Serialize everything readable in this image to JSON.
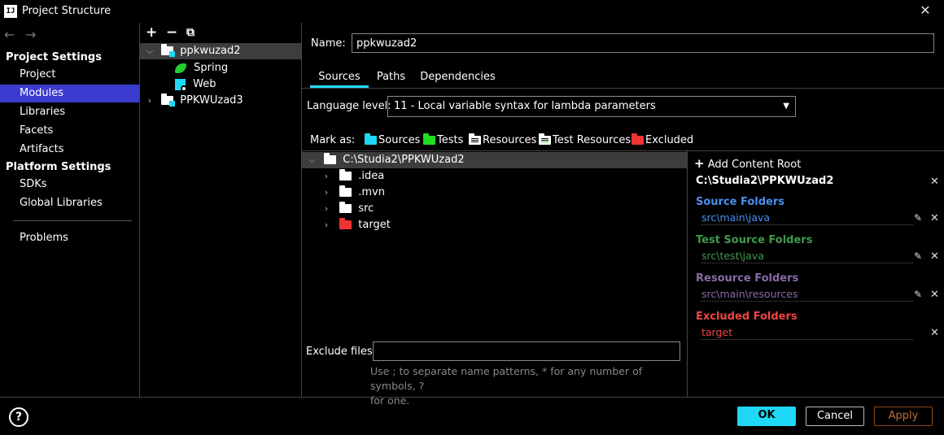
{
  "window": {
    "title": "Project Structure",
    "logo_text": "IJ",
    "close_glyph": "✕"
  },
  "nav": {
    "back_glyph": "←",
    "forward_glyph": "→",
    "project_settings_heading": "Project Settings",
    "project_items": [
      "Project",
      "Modules",
      "Libraries",
      "Facets",
      "Artifacts"
    ],
    "selected": "Modules",
    "platform_settings_heading": "Platform Settings",
    "platform_items": [
      "SDKs",
      "Global Libraries"
    ],
    "problems": "Problems"
  },
  "module_toolbar": {
    "add": "+",
    "remove": "−",
    "copy": "⧉"
  },
  "module_tree": {
    "module1": "ppkwuzad2",
    "facet_spring": "Spring",
    "facet_web": "Web",
    "module2": "PPKWUzad3"
  },
  "name_field": {
    "label": "Name:",
    "value": "ppkwuzad2"
  },
  "tabs": [
    "Sources",
    "Paths",
    "Dependencies"
  ],
  "selected_tab": "Sources",
  "language_level": {
    "label": "Language level:",
    "value": "11 - Local variable syntax for lambda parameters"
  },
  "mark_as": {
    "label": "Mark as:",
    "items": [
      {
        "label": "Sources",
        "color": "#1fd8f5"
      },
      {
        "label": "Tests",
        "color": "#22dd22"
      },
      {
        "label": "Resources",
        "color": "#ffffff"
      },
      {
        "label": "Test Resources",
        "color": "#ffffff"
      },
      {
        "label": "Excluded",
        "color": "#ee3333"
      }
    ]
  },
  "content_tree": {
    "root": "C:\\Studia2\\PPKWUzad2",
    "children": [
      {
        "name": ".idea",
        "color": "#ffffff"
      },
      {
        "name": ".mvn",
        "color": "#ffffff"
      },
      {
        "name": "src",
        "color": "#ffffff"
      },
      {
        "name": "target",
        "color": "#ee3333"
      }
    ]
  },
  "exclude_files": {
    "label": "Exclude files:",
    "value": "",
    "hint_line1": "Use ; to separate name patterns, * for any number of symbols, ?",
    "hint_line2": "for one."
  },
  "roots_panel": {
    "add_label": "Add Content Root",
    "root_path": "C:\\Studia2\\PPKWUzad2",
    "sections": [
      {
        "title": "Source Folders",
        "entry": "src\\main\\java",
        "color": "#4a8ef0",
        "entry_color": "#4a8ef0"
      },
      {
        "title": "Test Source Folders",
        "entry": "src\\test\\java",
        "color": "#3f9a4a",
        "entry_color": "#3f9a4a"
      },
      {
        "title": "Resource Folders",
        "entry": "src\\main\\resources",
        "color": "#8a6aa8",
        "entry_color": "#8a6aa8"
      },
      {
        "title": "Excluded Folders",
        "entry": "target",
        "color": "#ee4444",
        "entry_color": "#ee4444"
      }
    ]
  },
  "footer": {
    "help": "?",
    "ok": "OK",
    "cancel": "Cancel",
    "apply": "Apply"
  }
}
